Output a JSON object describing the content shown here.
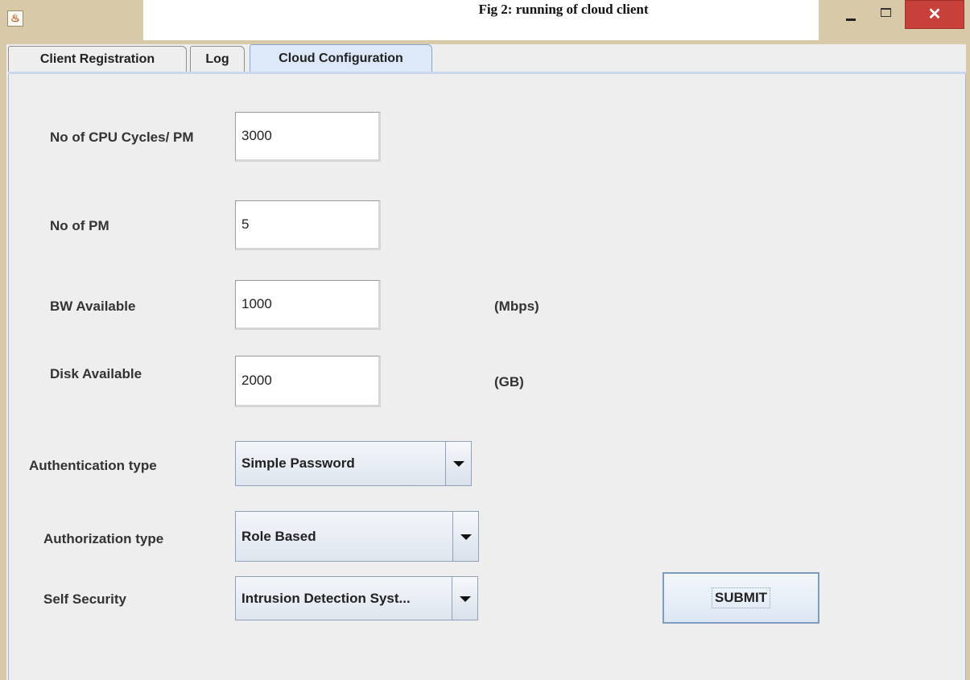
{
  "caption": "Fig 2: running of cloud client",
  "window": {
    "close_glyph": "✕",
    "icon_glyph": "♨"
  },
  "tabs": [
    {
      "label": "Client Registration"
    },
    {
      "label": "Log"
    },
    {
      "label": "Cloud Configuration",
      "selected": true
    }
  ],
  "form": {
    "cpu_cycles": {
      "label": "No of CPU Cycles/ PM",
      "value": "3000"
    },
    "num_pm": {
      "label": "No of PM",
      "value": "5"
    },
    "bw": {
      "label": "BW Available",
      "value": "1000",
      "unit": "(Mbps)"
    },
    "disk": {
      "label": "Disk Available",
      "value": "2000",
      "unit": "(GB)"
    },
    "authentication": {
      "label": "Authentication type",
      "selected": "Simple Password"
    },
    "authorization": {
      "label": "Authorization type",
      "selected": "Role Based"
    },
    "self_security": {
      "label": "Self Security",
      "selected": "Intrusion Detection Syst..."
    },
    "submit_label": "SUBMIT"
  },
  "colors": {
    "frame": "#d8c9a8",
    "close_button": "#c7403a",
    "selected_tab": "#dce8f7"
  }
}
